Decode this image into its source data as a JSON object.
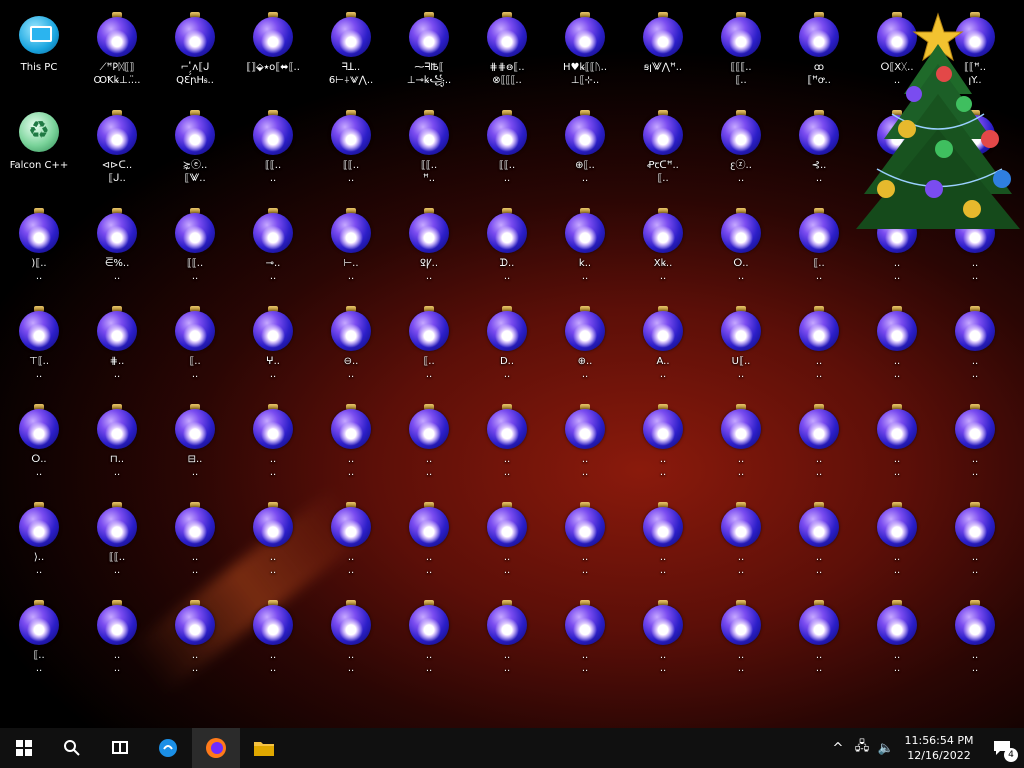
{
  "desktop": {
    "icons": [
      "This PC",
      "⟋ꟸ𐌓ᛞ⟦⟧\nꝎꝀꝃ⊥..̈..",
      "⌐ ̗̗̔ʌ⟦ᒍ\nQƐꞃHꭶ..",
      "⟦⟧⬙⭑o⟦⬌⟦..",
      "ᖷꓕ..\n6⊢⍭⨈⋀..",
      "⁓ᖷꙒ⟦\n⊥⊸ꝃ꧁..",
      "⋕⋕ꙫ⟦..\n⊗⟦⟦⟦..",
      "H♥ꝃ⟦⟦ᚢ..\n⊥⟦⊹..",
      "ꞩꞁ⨈⋀ꟸ..",
      "⟦⟦⟦..\n⟦..",
      "ꝏ\n⟦ꟸꝍ..",
      "ⵔ⟦Xᚷ..\n..",
      "⟦⟦ꟸ..\nꞁY..",
      "Falcon C++",
      "⊲⊳ᑕ..\n⟦ᒍ..",
      "⋩ⓔ..\n⟦⨈..",
      "⟦⟦..\n..",
      "⟦⟦..\n..",
      "⟦⟦..\nꟸ..",
      "⟦⟦..\n..",
      "⊕⟦..\n..",
      "Ꝓꞇᑕꟸ..\n⟦..",
      "ꜫⓩ..\n..",
      "⊰..\n..",
      "⊡..\n..",
      "⟦..\n..",
      ")⟦..\n..",
      "⋶%..\n..",
      "⟦⟦..\n..",
      "⊸..\n..",
      "⊢..\n..",
      "ꝾꝨ..\n..",
      "ᗪ..\n..",
      "k..\n..",
      "Xꝃ..\n..",
      "ⵔ..\n..",
      "⟦..\n..",
      "..\n..",
      "..\n..",
      "⊤⟦..\n..",
      "⋕..\n..",
      "⟦..\n..",
      "ⵖ..\n..",
      "⊖..\n..",
      "⟦..\n..",
      "D..\n..",
      "⊕..\n..",
      "A..\n..",
      "U⟦..\n..",
      "..\n..",
      "..\n..",
      "..\n..",
      "ⵔ..\n..",
      "⊓..\n..",
      "⊟..\n..",
      "..\n..",
      "..\n..",
      "..\n..",
      "..\n..",
      "..\n..",
      "..\n..",
      "..\n..",
      "..\n..",
      "..\n..",
      "..\n..",
      "⟩..\n..",
      "⟦⟦..\n..",
      "..\n..",
      "..\n..",
      "..\n..",
      "..\n..",
      "..\n..",
      "..\n..",
      "..\n..",
      "..\n..",
      "..\n..",
      "..\n..",
      "..\n..",
      "⟦..\n..",
      "..\n..",
      "..\n..",
      "..\n..",
      "..\n..",
      "..\n..",
      "..\n..",
      "..\n..",
      "..\n..",
      "..\n..",
      "..\n..",
      "..\n..",
      "..\n.."
    ]
  },
  "taskbar": {
    "start_icon": "windows-logo",
    "search_icon": "search-icon",
    "taskview_icon": "task-view-icon",
    "pinned": [
      "edge-icon",
      "firefox-icon",
      "file-explorer-icon"
    ],
    "tray": {
      "chevron": "^",
      "time": "11:56:54 PM",
      "date": "12/16/2022",
      "notification_count": "4"
    }
  },
  "colors": {
    "taskbar": "#101010",
    "ornament_blue": "#2b1ec8",
    "accent_red": "#8a1a0c"
  }
}
